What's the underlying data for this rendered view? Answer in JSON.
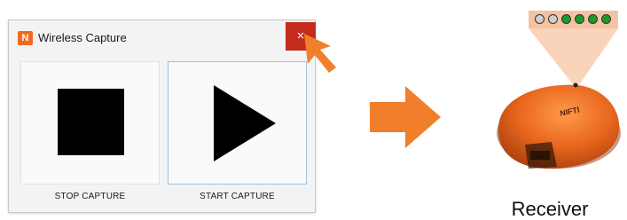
{
  "window": {
    "title": "Wireless Capture",
    "app_icon_glyph": "N",
    "close_glyph": "×"
  },
  "buttons": {
    "stop_label": "STOP CAPTURE",
    "start_label": "START CAPTURE"
  },
  "receiver": {
    "label": "Receiver",
    "device_brand": "NIFTI",
    "leds": [
      "off",
      "off",
      "on",
      "on",
      "on",
      "on"
    ]
  },
  "colors": {
    "accent_orange": "#f07e2a",
    "close_red": "#c42b1c",
    "led_on": "#1c9b2c",
    "led_off": "#cfcfcf"
  }
}
